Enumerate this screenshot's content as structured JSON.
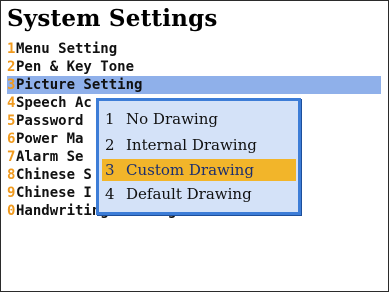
{
  "screen": {
    "title": "System Settings",
    "items": [
      {
        "num": "1",
        "label": "Menu Setting"
      },
      {
        "num": "2",
        "label": "Pen & Key Tone"
      },
      {
        "num": "3",
        "label": "Picture Setting"
      },
      {
        "num": "4",
        "label": "Speech Ac"
      },
      {
        "num": "5",
        "label": "Password"
      },
      {
        "num": "6",
        "label": "Power Ma"
      },
      {
        "num": "7",
        "label": "Alarm Se"
      },
      {
        "num": "8",
        "label": "Chinese S"
      },
      {
        "num": "9",
        "label": "Chinese I"
      },
      {
        "num": "0",
        "label": "Handwriting Setting"
      }
    ],
    "selected_index": 2
  },
  "popup": {
    "options": [
      {
        "num": "1",
        "label": "No Drawing"
      },
      {
        "num": "2",
        "label": "Internal Drawing"
      },
      {
        "num": "3",
        "label": "Custom Drawing"
      },
      {
        "num": "4",
        "label": "Default Drawing"
      }
    ],
    "selected_index": 2
  },
  "colors": {
    "number_accent": "#f09a1e",
    "list_highlight": "#8fb0ea",
    "popup_bg": "#d4e2f8",
    "popup_border": "#3d7dd7",
    "popup_highlight": "#f2b52a"
  }
}
